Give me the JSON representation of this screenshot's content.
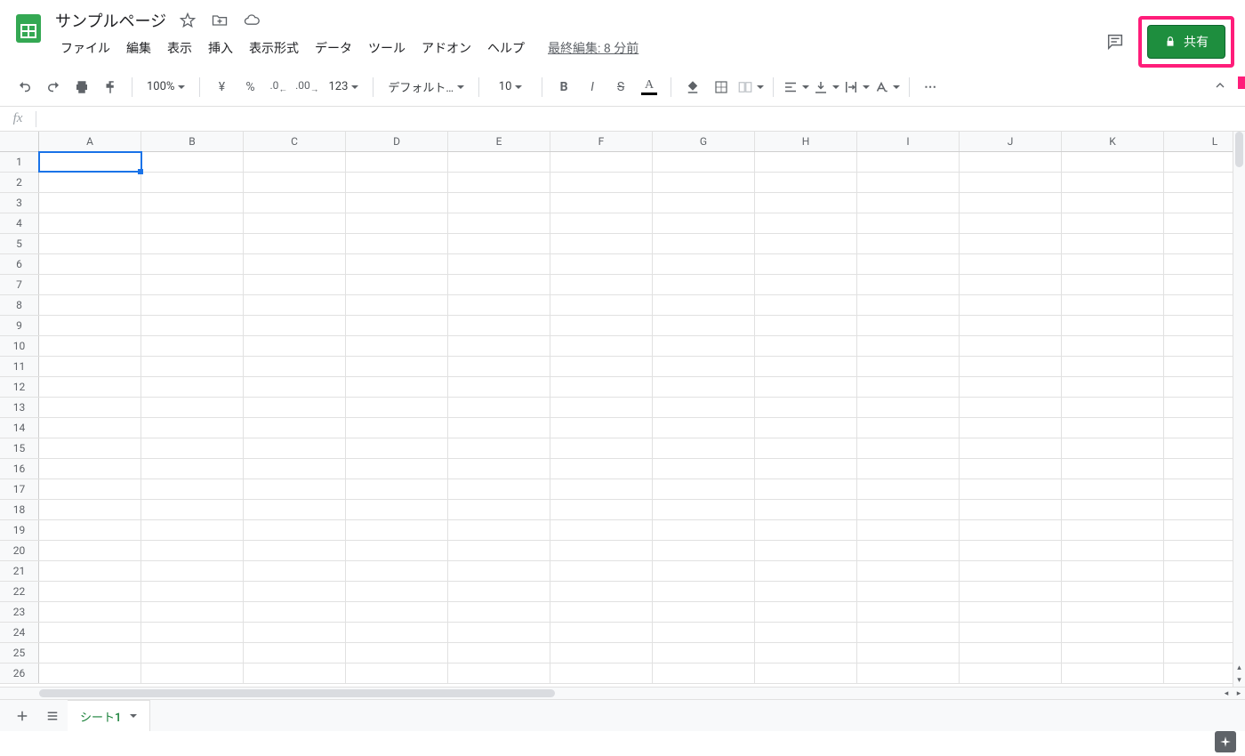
{
  "header": {
    "doc_title": "サンプルページ",
    "menus": [
      "ファイル",
      "編集",
      "表示",
      "挿入",
      "表示形式",
      "データ",
      "ツール",
      "アドオン",
      "ヘルプ"
    ],
    "last_edit": "最終編集: 8 分前",
    "share_label": "共有"
  },
  "toolbar": {
    "zoom": "100%",
    "font": "デフォルト…",
    "font_size": "10",
    "number_fmt": "123"
  },
  "formula_bar": {
    "fx_label": "fx",
    "value": ""
  },
  "grid": {
    "columns": [
      "A",
      "B",
      "C",
      "D",
      "E",
      "F",
      "G",
      "H",
      "I",
      "J",
      "K",
      "L"
    ],
    "row_count": 26,
    "selected_cell": "A1"
  },
  "tabs": {
    "active": "シート1"
  },
  "colors": {
    "accent": "#188038",
    "share_green": "#1e8e3e",
    "highlight_box": "#ff1d7a",
    "selection": "#1a73e8"
  }
}
